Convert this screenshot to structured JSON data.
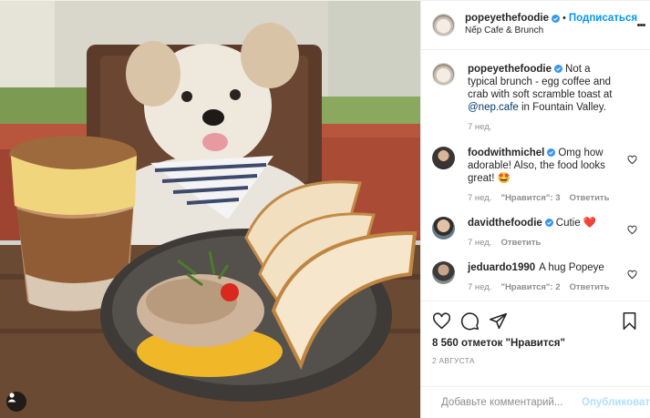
{
  "header": {
    "username": "popeyethefoodie",
    "separator": "•",
    "follow_label": "Подписаться",
    "location": "Nếp Cafe & Brunch"
  },
  "caption": {
    "username": "popeyethefoodie",
    "text_before": "Not a typical brunch - egg coffee and crab with soft scramble toast at ",
    "mention": "@nep.cafe",
    "text_after": " in Fountain Valley.",
    "time": "7 нед."
  },
  "comments": [
    {
      "username": "foodwithmichel",
      "verified": true,
      "text": "Omg how adorable! Also, the food looks great! 🤩",
      "time": "7 нед.",
      "likes": "\"Нравится\": 3",
      "reply": "Ответить"
    },
    {
      "username": "davidthefoodie",
      "verified": true,
      "text": "Cutie ❤️",
      "time": "7 нед.",
      "likes": "",
      "reply": "Ответить"
    },
    {
      "username": "jeduardo1990",
      "verified": false,
      "text": "A hug Popeye",
      "time": "7 нед.",
      "likes": "\"Нравится\": 2",
      "reply": "Ответить"
    }
  ],
  "actions": {
    "likes_text": "8 560 отметок \"Нравится\"",
    "date": "2 АВГУСТА"
  },
  "add_comment": {
    "placeholder": "Добавьте комментарий...",
    "publish_label": "Опубликовать"
  },
  "icons": [
    "heart-icon",
    "comment-icon",
    "share-icon",
    "bookmark-icon",
    "emoji-icon",
    "more-icon",
    "verified-icon",
    "user-tag-icon"
  ],
  "colors": {
    "accent": "#0095f6",
    "verified": "#3897f0",
    "muted": "#8e8e8e",
    "publish_disabled": "#b2dffc",
    "mention": "#00376b"
  }
}
